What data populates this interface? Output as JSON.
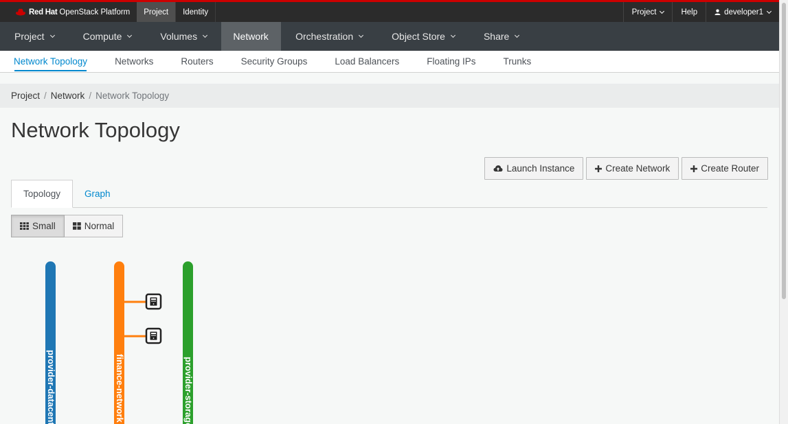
{
  "brand": {
    "red": "Red Hat",
    "rest": "OpenStack Platform"
  },
  "topbar": {
    "tabs": [
      {
        "label": "Project",
        "active": true
      },
      {
        "label": "Identity",
        "active": false
      }
    ],
    "right": {
      "project_menu": "Project",
      "help": "Help",
      "user": "developer1"
    }
  },
  "mainnav": [
    {
      "label": "Project",
      "dropdown": true
    },
    {
      "label": "Compute",
      "dropdown": true
    },
    {
      "label": "Volumes",
      "dropdown": true
    },
    {
      "label": "Network",
      "dropdown": false,
      "active": true
    },
    {
      "label": "Orchestration",
      "dropdown": true
    },
    {
      "label": "Object Store",
      "dropdown": true
    },
    {
      "label": "Share",
      "dropdown": true
    }
  ],
  "subnav": [
    "Network Topology",
    "Networks",
    "Routers",
    "Security Groups",
    "Load Balancers",
    "Floating IPs",
    "Trunks"
  ],
  "breadcrumb": [
    "Project",
    "Network",
    "Network Topology"
  ],
  "page_title": "Network Topology",
  "actions": {
    "launch_instance": "Launch Instance",
    "create_network": "Create Network",
    "create_router": "Create Router"
  },
  "tabs": {
    "topology": "Topology",
    "graph": "Graph"
  },
  "sizes": {
    "small": "Small",
    "normal": "Normal"
  },
  "topology": {
    "networks": [
      {
        "name": "provider-datacenter",
        "color": "#1f77b4",
        "instances": 0
      },
      {
        "name": "finance-network",
        "color": "#ff7f0e",
        "instances": 2
      },
      {
        "name": "provider-storage",
        "color": "#2ca02c",
        "instances": 0
      }
    ]
  },
  "colors": {
    "accent": "#0088ce",
    "brand_red": "#cc0000"
  }
}
